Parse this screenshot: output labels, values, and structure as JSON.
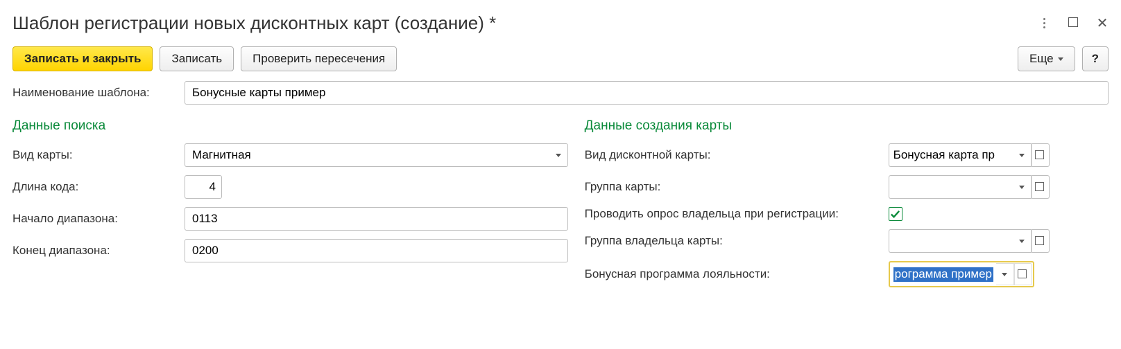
{
  "window": {
    "title": "Шаблон регистрации новых дисконтных карт (создание) *"
  },
  "toolbar": {
    "save_close": "Записать и закрыть",
    "save": "Записать",
    "check": "Проверить пересечения",
    "more": "Еще",
    "help": "?"
  },
  "template_name": {
    "label": "Наименование шаблона:",
    "value": "Бонусные карты пример"
  },
  "sections": {
    "search": "Данные поиска",
    "creation": "Данные создания карты"
  },
  "search": {
    "card_type": {
      "label": "Вид карты:",
      "value": "Магнитная"
    },
    "code_length": {
      "label": "Длина кода:",
      "value": "4"
    },
    "range_start": {
      "label": "Начало диапазона:",
      "value": "0113"
    },
    "range_end": {
      "label": "Конец диапазона:",
      "value": "0200"
    }
  },
  "creation": {
    "discount_card_type": {
      "label": "Вид дисконтной карты:",
      "value": "Бонусная карта пр"
    },
    "card_group": {
      "label": "Группа карты:",
      "value": ""
    },
    "survey": {
      "label": "Проводить опрос владельца при регистрации:",
      "checked": true
    },
    "owner_group": {
      "label": "Группа владельца карты:",
      "value": ""
    },
    "loyalty_program": {
      "label": "Бонусная программа лояльности:",
      "value": "рограмма пример"
    }
  }
}
